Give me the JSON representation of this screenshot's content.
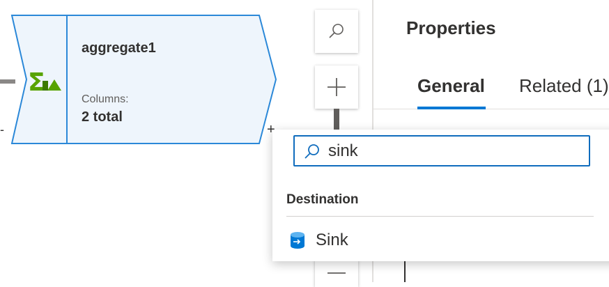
{
  "node": {
    "title": "aggregate1",
    "columns_label": "Columns:",
    "columns_value": "2 total",
    "icon": "aggregate-sigma-icon",
    "colors": {
      "fill": "#eef5fc",
      "border": "#2b88d8",
      "icon_green": "#57a300"
    }
  },
  "toolbar": {
    "search_icon": "search-icon",
    "add_icon": "plus-icon",
    "zoom_out_icon": "minus-icon"
  },
  "properties": {
    "title": "Properties",
    "tabs": [
      {
        "label": "General",
        "active": true
      },
      {
        "label": "Related (1)",
        "active": false
      }
    ],
    "accent": "#0078d4"
  },
  "popup": {
    "search_value": "sink",
    "section": "Destination",
    "items": [
      {
        "label": "Sink",
        "icon": "sink-cylinder-icon"
      }
    ]
  }
}
